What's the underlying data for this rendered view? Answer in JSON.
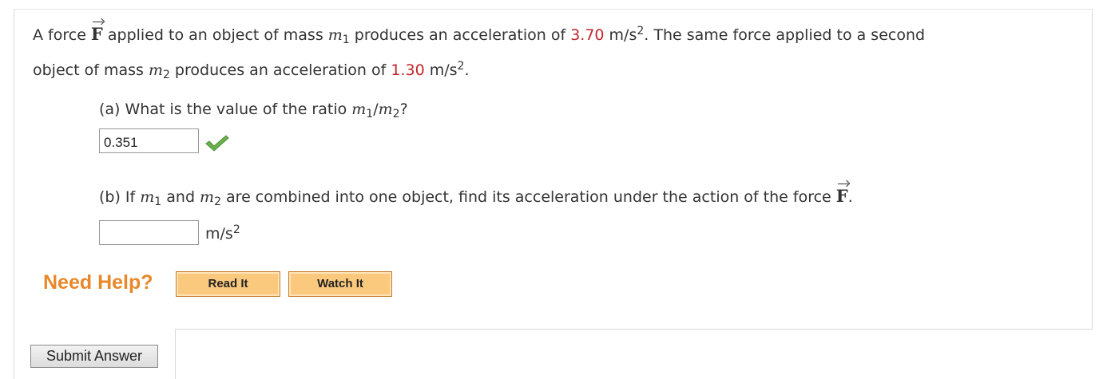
{
  "problem": {
    "line1_a": "A force ",
    "force_symbol": "F",
    "line1_b": " applied to an object of mass ",
    "mass_symbol": "m",
    "sub_1": "1",
    "sub_2": "2",
    "line1_c": " produces an acceleration of ",
    "accel1_value": "3.70",
    "unit_ms": " m/s",
    "sup_2": "2",
    "line1_d": ". The same force applied to a second",
    "line2_a": "object of mass ",
    "line2_b": " produces an acceleration of ",
    "accel2_value": "1.30",
    "line2_end": "."
  },
  "part_a": {
    "question_a": "(a) What is the value of the ratio ",
    "slash": "/",
    "question_end": "?",
    "answer_value": "0.351",
    "status_icon": "check-icon",
    "check_color": "#6ab04c"
  },
  "part_b": {
    "question_a": "(b) If ",
    "question_b": " and ",
    "question_c": " are combined into one object, find its acceleration under the action of the force ",
    "question_end": ".",
    "answer_value": "",
    "unit": "m/s",
    "unit_sup": "2"
  },
  "help": {
    "label": "Need Help?",
    "read_it": "Read It",
    "watch_it": "Watch It",
    "label_color": "#e8882a",
    "button_color": "#fbc97e"
  },
  "submit": {
    "label": "Submit Answer"
  },
  "colors": {
    "highlight": "#c1272d",
    "text": "#333333"
  }
}
